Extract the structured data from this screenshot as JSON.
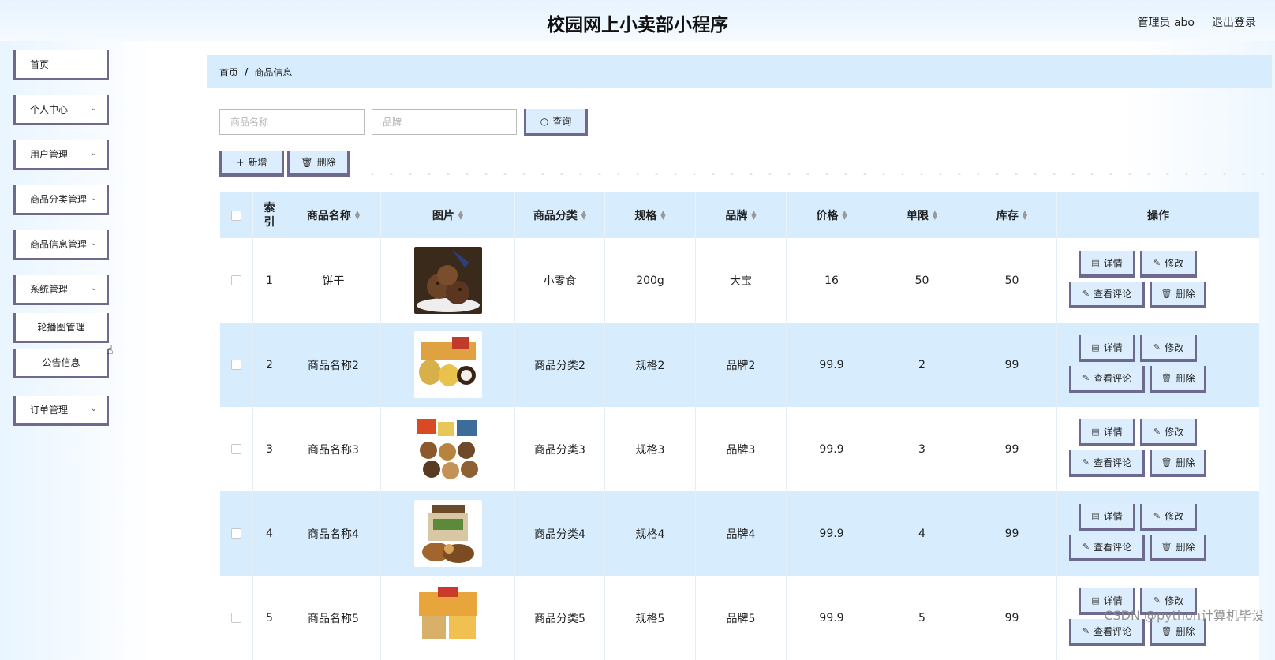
{
  "header": {
    "title": "校园网上小卖部小程序",
    "user_label": "管理员 abo",
    "logout_label": "退出登录"
  },
  "sidebar": {
    "items": [
      {
        "label": "首页"
      },
      {
        "label": "个人中心"
      },
      {
        "label": "用户管理"
      },
      {
        "label": "商品分类管理"
      },
      {
        "label": "商品信息管理"
      },
      {
        "label": "系统管理"
      },
      {
        "label": "轮播图管理"
      },
      {
        "label": "公告信息"
      },
      {
        "label": "订单管理"
      }
    ]
  },
  "breadcrumb": {
    "home": "首页",
    "separator": "/",
    "current": "商品信息"
  },
  "search": {
    "name_placeholder": "商品名称",
    "brand_placeholder": "品牌",
    "query_label": "查询"
  },
  "toolbar": {
    "add_label": "新增",
    "delete_label": "删除"
  },
  "table": {
    "headers": [
      "索引",
      "商品名称",
      "图片",
      "商品分类",
      "规格",
      "品牌",
      "价格",
      "单限",
      "库存",
      "操作"
    ],
    "actions": {
      "detail": "详情",
      "edit": "修改",
      "review": "查看评论",
      "delete": "删除"
    },
    "rows": [
      {
        "index": "1",
        "name": "饼干",
        "image": "cookie-photo",
        "category": "小零食",
        "spec": "200g",
        "brand": "大宝",
        "price": "16",
        "limit": "50",
        "stock": "50"
      },
      {
        "index": "2",
        "name": "商品名称2",
        "image": "snack-pastry-photo",
        "category": "商品分类2",
        "spec": "规格2",
        "brand": "品牌2",
        "price": "99.9",
        "limit": "2",
        "stock": "99"
      },
      {
        "index": "3",
        "name": "商品名称3",
        "image": "mixed-nuts-photo",
        "category": "商品分类3",
        "spec": "规格3",
        "brand": "品牌3",
        "price": "99.9",
        "limit": "3",
        "stock": "99"
      },
      {
        "index": "4",
        "name": "商品名称4",
        "image": "nut-jar-photo",
        "category": "商品分类4",
        "spec": "规格4",
        "brand": "品牌4",
        "price": "99.9",
        "limit": "4",
        "stock": "99"
      },
      {
        "index": "5",
        "name": "商品名称5",
        "image": "bread-snacks-photo",
        "category": "商品分类5",
        "spec": "规格5",
        "brand": "品牌5",
        "price": "99.9",
        "limit": "5",
        "stock": "99"
      }
    ]
  },
  "watermark": "CSDN @python计算机毕设",
  "colors": {
    "accent": "#d7ecfd",
    "border": "#6e6a8f"
  }
}
